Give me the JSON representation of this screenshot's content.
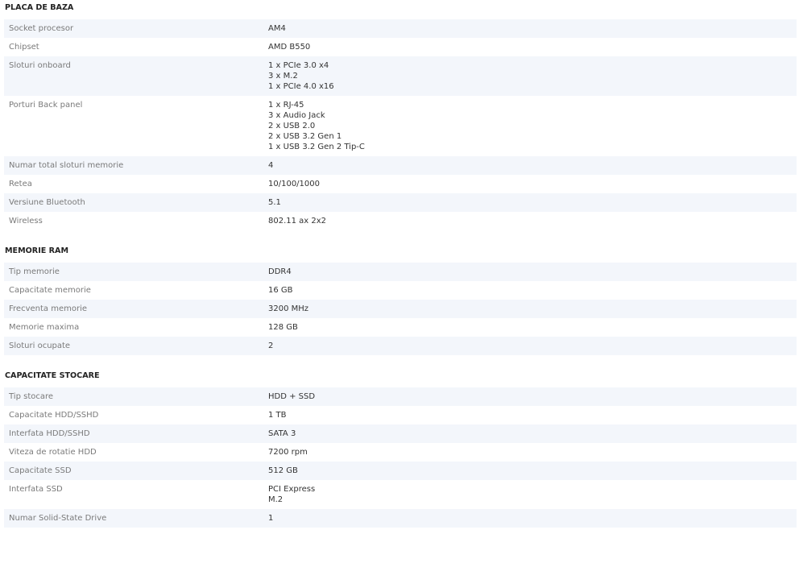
{
  "sections": [
    {
      "title": "PLACA DE BAZA",
      "rows": [
        {
          "label": "Socket procesor",
          "values": [
            "AM4"
          ]
        },
        {
          "label": "Chipset",
          "values": [
            "AMD B550"
          ]
        },
        {
          "label": "Sloturi onboard",
          "values": [
            "1 x PCIe 3.0 x4",
            "3 x M.2",
            "1 x PCIe 4.0 x16"
          ]
        },
        {
          "label": "Porturi Back panel",
          "values": [
            "1 x RJ-45",
            "3 x Audio Jack",
            "2 x USB 2.0",
            "2 x USB 3.2 Gen 1",
            "1 x USB 3.2 Gen 2 Tip-C"
          ]
        },
        {
          "label": "Numar total sloturi memorie",
          "values": [
            "4"
          ]
        },
        {
          "label": "Retea",
          "values": [
            "10/100/1000"
          ]
        },
        {
          "label": "Versiune Bluetooth",
          "values": [
            "5.1"
          ]
        },
        {
          "label": "Wireless",
          "values": [
            "802.11 ax 2x2"
          ]
        }
      ]
    },
    {
      "title": "MEMORIE RAM",
      "rows": [
        {
          "label": "Tip memorie",
          "values": [
            "DDR4"
          ]
        },
        {
          "label": "Capacitate memorie",
          "values": [
            "16 GB"
          ]
        },
        {
          "label": "Frecventa memorie",
          "values": [
            "3200 MHz"
          ]
        },
        {
          "label": "Memorie maxima",
          "values": [
            "128 GB"
          ]
        },
        {
          "label": "Sloturi ocupate",
          "values": [
            "2"
          ]
        }
      ]
    },
    {
      "title": "CAPACITATE STOCARE",
      "rows": [
        {
          "label": "Tip stocare",
          "values": [
            "HDD + SSD"
          ]
        },
        {
          "label": "Capacitate HDD/SSHD",
          "values": [
            "1 TB"
          ]
        },
        {
          "label": "Interfata HDD/SSHD",
          "values": [
            "SATA 3"
          ]
        },
        {
          "label": "Viteza de rotatie HDD",
          "values": [
            "7200 rpm"
          ]
        },
        {
          "label": "Capacitate SSD",
          "values": [
            "512 GB"
          ]
        },
        {
          "label": "Interfata SSD",
          "values": [
            "PCI Express",
            "M.2"
          ]
        },
        {
          "label": "Numar Solid-State Drive",
          "values": [
            "1"
          ]
        }
      ]
    }
  ]
}
